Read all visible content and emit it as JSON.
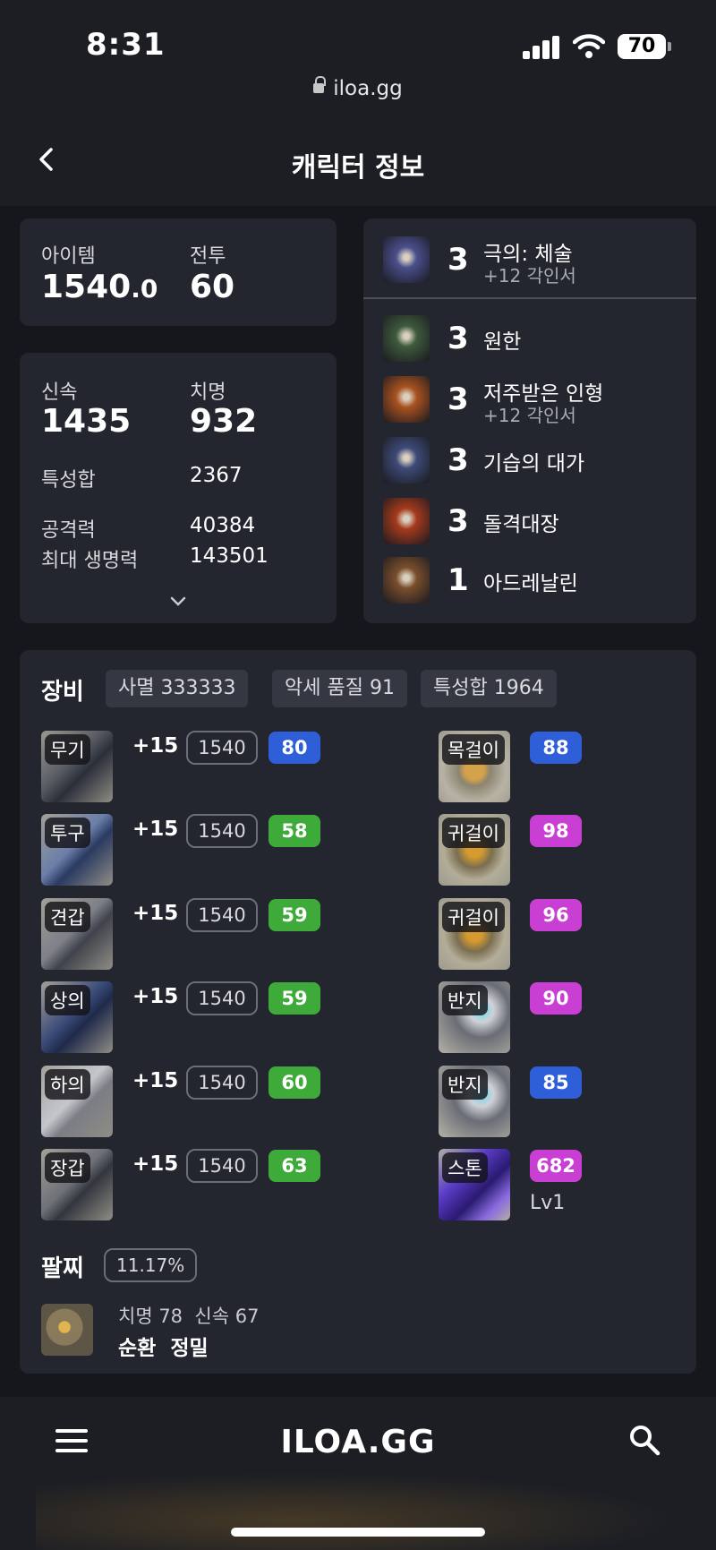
{
  "status": {
    "time": "8:31",
    "battery": "70",
    "url": "iloa.gg"
  },
  "header": {
    "title": "캐릭터 정보"
  },
  "summary": {
    "item_label": "아이템",
    "item_value": "1540",
    "item_decimal": ".0",
    "combat_label": "전투",
    "combat_value": "60"
  },
  "stats": {
    "swift_label": "신속",
    "swift_value": "1435",
    "crit_label": "치명",
    "crit_value": "932",
    "total_label": "특성합",
    "total_value": "2367",
    "attack_label": "공격력",
    "attack_value": "40384",
    "hp_label": "최대 생명력",
    "hp_value": "143501"
  },
  "engravings": [
    {
      "level": "3",
      "name": "극의: 체술",
      "sub": "+12 각인서",
      "icon": "fist-engraving-icon",
      "color": "#4a4f8c"
    },
    {
      "level": "3",
      "name": "원한",
      "sub": "",
      "icon": "grudge-engraving-icon",
      "color": "#3f5a3c"
    },
    {
      "level": "3",
      "name": "저주받은 인형",
      "sub": "+12 각인서",
      "icon": "cursed-doll-engraving-icon",
      "color": "#a9521f"
    },
    {
      "level": "3",
      "name": "기습의 대가",
      "sub": "",
      "icon": "ambush-engraving-icon",
      "color": "#3e4b78"
    },
    {
      "level": "3",
      "name": "돌격대장",
      "sub": "",
      "icon": "vanguard-engraving-icon",
      "color": "#a53a1c"
    },
    {
      "level": "1",
      "name": "아드레날린",
      "sub": "",
      "icon": "adrenaline-engraving-icon",
      "color": "#7a4e2c"
    }
  ],
  "equipment": {
    "title": "장비",
    "chips": [
      "사멸 333333",
      "악세 품질 91",
      "특성합 1964"
    ],
    "armor": [
      {
        "slot": "무기",
        "plus": "+15",
        "level": "1540",
        "quality": "80",
        "qcolor": "#2f5fd8"
      },
      {
        "slot": "투구",
        "plus": "+15",
        "level": "1540",
        "quality": "58",
        "qcolor": "#3eaa3a"
      },
      {
        "slot": "견갑",
        "plus": "+15",
        "level": "1540",
        "quality": "59",
        "qcolor": "#3eaa3a"
      },
      {
        "slot": "상의",
        "plus": "+15",
        "level": "1540",
        "quality": "59",
        "qcolor": "#3eaa3a"
      },
      {
        "slot": "하의",
        "plus": "+15",
        "level": "1540",
        "quality": "60",
        "qcolor": "#3eaa3a"
      },
      {
        "slot": "장갑",
        "plus": "+15",
        "level": "1540",
        "quality": "63",
        "qcolor": "#3eaa3a"
      }
    ],
    "accessories": [
      {
        "slot": "목걸이",
        "quality": "88",
        "qcolor": "#2f5fd8"
      },
      {
        "slot": "귀걸이",
        "quality": "98",
        "qcolor": "#c93fd4"
      },
      {
        "slot": "귀걸이",
        "quality": "96",
        "qcolor": "#c93fd4"
      },
      {
        "slot": "반지",
        "quality": "90",
        "qcolor": "#c93fd4"
      },
      {
        "slot": "반지",
        "quality": "85",
        "qcolor": "#2f5fd8"
      },
      {
        "slot": "스톤",
        "quality": "682",
        "qcolor": "#c93fd4",
        "extra": "Lv1"
      }
    ]
  },
  "bracelet": {
    "title": "팔찌",
    "percent": "11.17%",
    "stats": "치명 78  신속 67",
    "effects": "순환  정밀"
  },
  "bottom": {
    "brand": "ILOA.GG"
  }
}
